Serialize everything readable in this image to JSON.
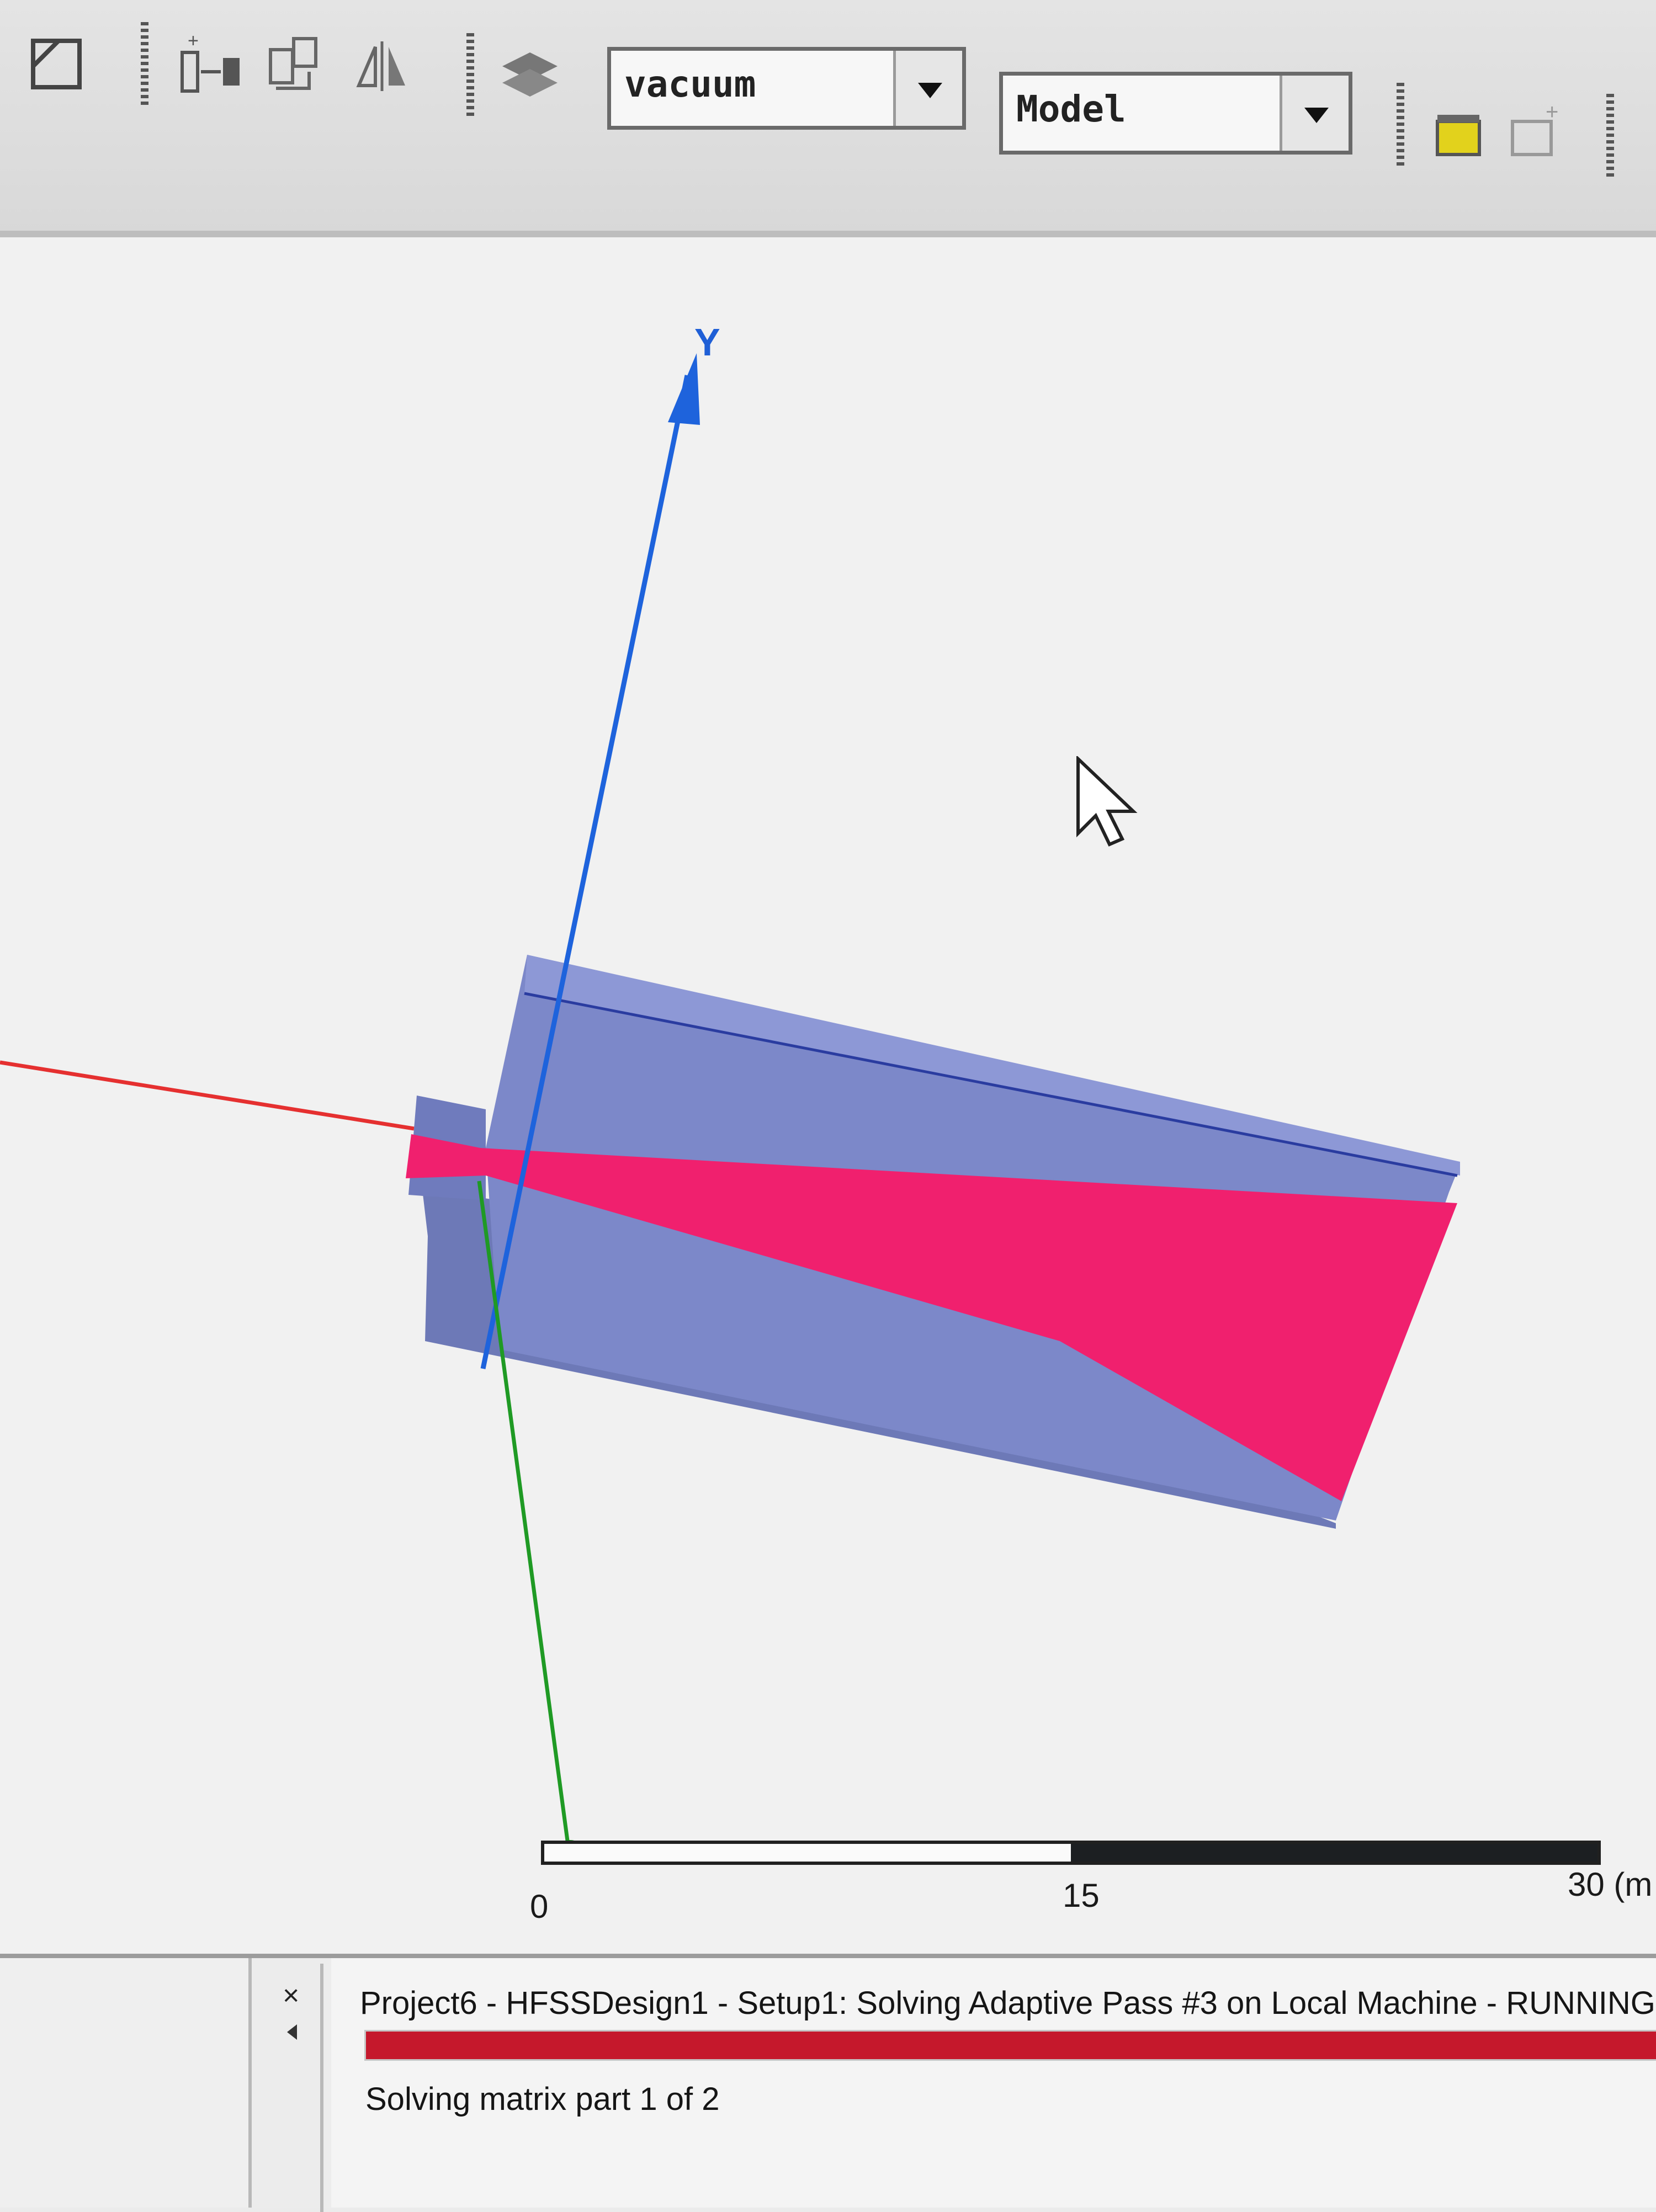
{
  "toolbar": {
    "material_combo": {
      "value": "vacuum"
    },
    "view_combo": {
      "value": "Model"
    },
    "icons": [
      "draw-box-icon",
      "add-object-icon",
      "boolean-operations-icon",
      "mirror-icon",
      "material-stack-icon",
      "fit-all-icon",
      "create-object-icon"
    ]
  },
  "viewport": {
    "axis_y_label": "Y",
    "ruler": {
      "tick_labels": [
        "0",
        "15",
        "30 (m"
      ]
    },
    "model_colors": {
      "dielectric": "#7a86c8",
      "horn_surface": "#f0206e"
    }
  },
  "status_panel": {
    "job_text": "Project6 - HFSSDesign1 - Setup1: Solving Adaptive Pass #3  on Local Machine - RUNNING",
    "progress": 1.0,
    "progress_color": "#c5182c",
    "sub_status": "Solving matrix part 1 of 2"
  }
}
